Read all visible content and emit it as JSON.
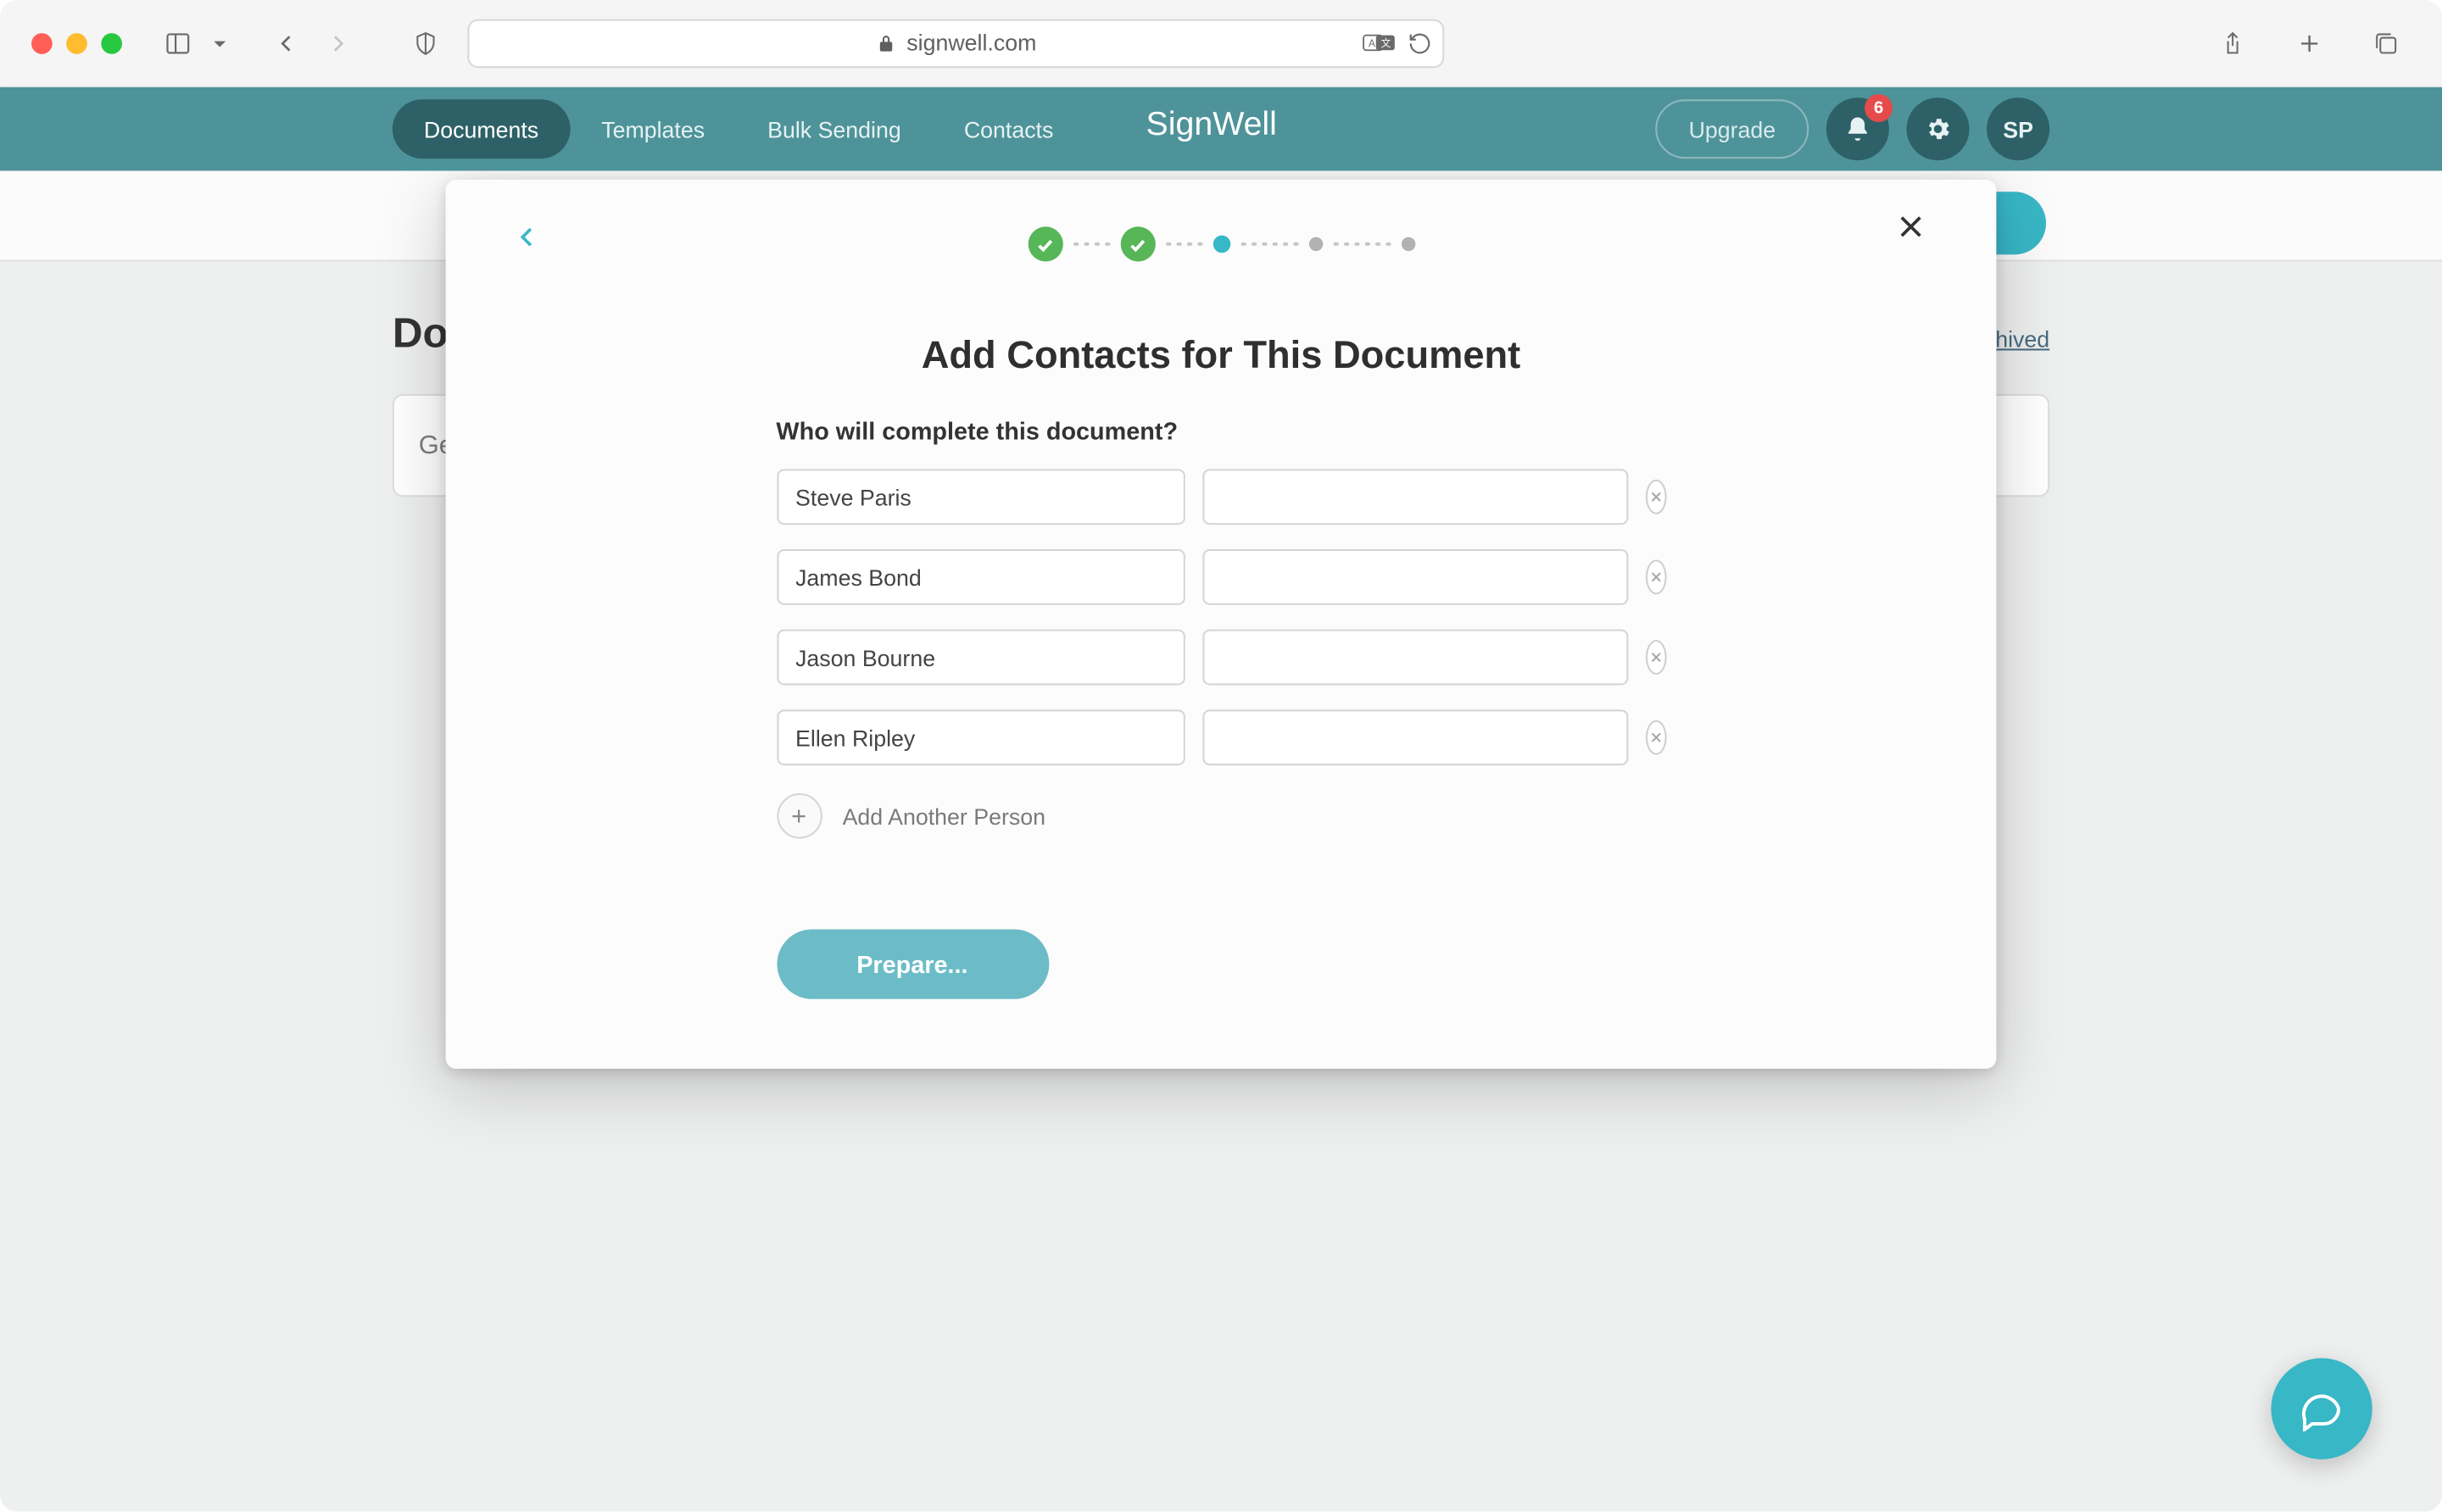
{
  "browser": {
    "url_host": "signwell.com"
  },
  "header": {
    "nav": [
      {
        "label": "Documents"
      },
      {
        "label": "Templates"
      },
      {
        "label": "Bulk Sending"
      },
      {
        "label": "Contacts"
      }
    ],
    "brand": "SignWell",
    "upgrade_label": "Upgrade",
    "badge_count": "6",
    "avatar_initials": "SP"
  },
  "page": {
    "title_prefix": "Doc",
    "archived_suffix": "hived",
    "empty_prefix": "Ge"
  },
  "modal": {
    "title": "Add Contacts for This Document",
    "subtitle": "Who will complete this document?",
    "contacts": [
      {
        "name": "Steve Paris",
        "email": ""
      },
      {
        "name": "James Bond",
        "email": ""
      },
      {
        "name": "Jason Bourne",
        "email": ""
      },
      {
        "name": "Ellen Ripley",
        "email": ""
      }
    ],
    "add_label": "Add Another Person",
    "submit_label": "Prepare..."
  }
}
